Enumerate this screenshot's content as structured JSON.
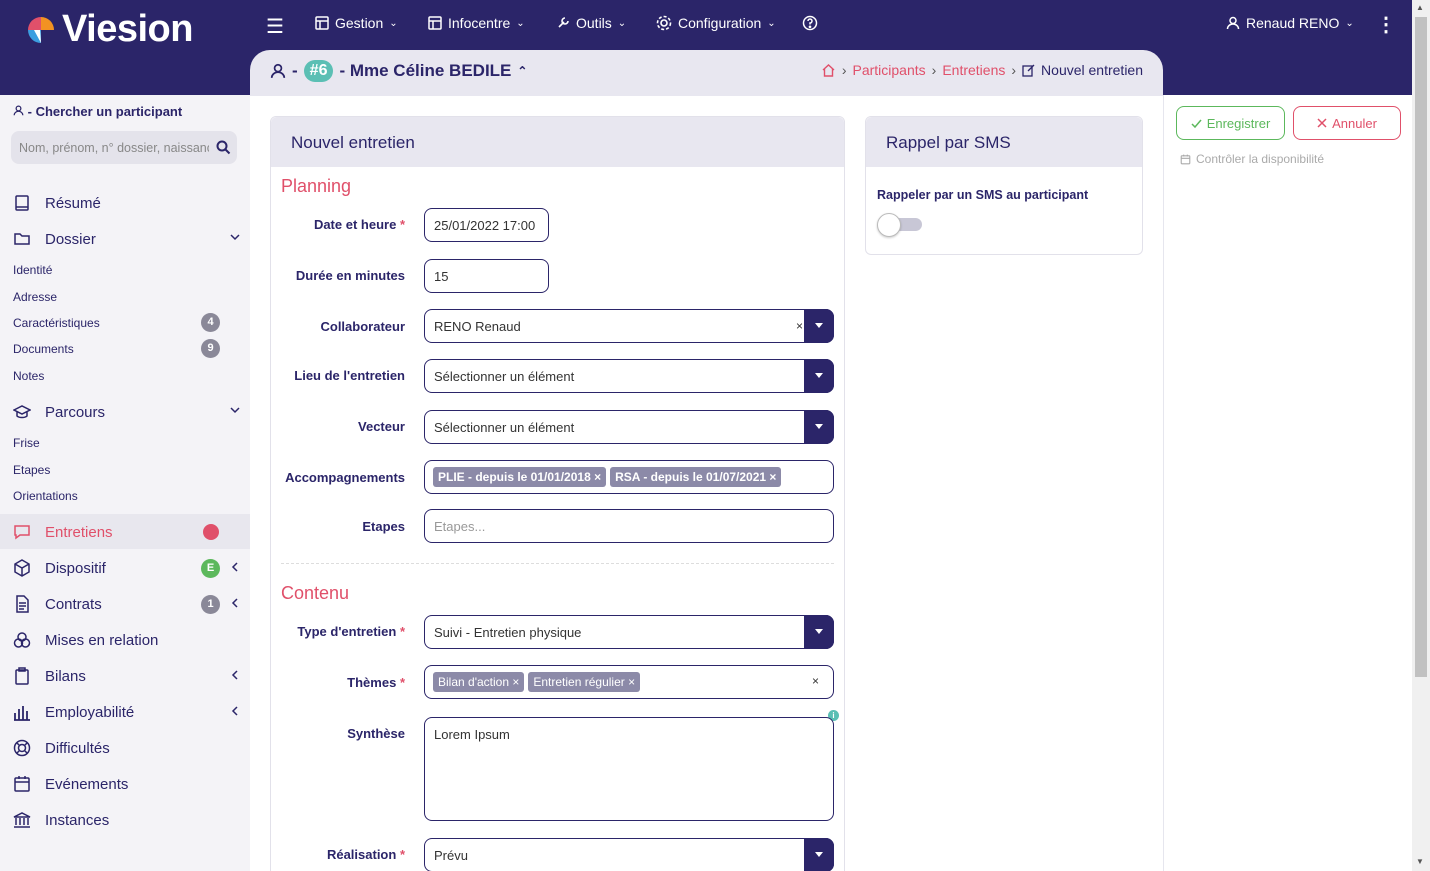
{
  "app": {
    "logo": "Viesion"
  },
  "nav": {
    "gestion": "Gestion",
    "infocentre": "Infocentre",
    "outils": "Outils",
    "configuration": "Configuration",
    "user": "Renaud RENO"
  },
  "participant": {
    "prefix": "-",
    "badge": "#6",
    "name": "- Mme Céline BEDILE"
  },
  "breadcrumb": {
    "participants": "Participants",
    "entretiens": "Entretiens",
    "current": "Nouvel entretien",
    "sep": "›"
  },
  "sidebar": {
    "search_label": "- Chercher un participant",
    "search_placeholder": "Nom, prénom, n° dossier, naissance",
    "resume": "Résumé",
    "dossier": "Dossier",
    "dossier_sub": [
      "Identité",
      "Adresse",
      "Caractéristiques",
      "Documents",
      "Notes"
    ],
    "count_caract": "4",
    "count_docs": "9",
    "parcours": "Parcours",
    "parcours_sub": [
      "Frise",
      "Etapes",
      "Orientations"
    ],
    "entretiens": "Entretiens",
    "dispositif": "Dispositif",
    "dispositif_badge": "E",
    "contrats": "Contrats",
    "contrats_count": "1",
    "mises": "Mises en relation",
    "bilans": "Bilans",
    "employabilite": "Employabilité",
    "difficultes": "Difficultés",
    "evenements": "Evénements",
    "instances": "Instances"
  },
  "form": {
    "title": "Nouvel entretien",
    "planning": "Planning",
    "date_label": "Date et heure",
    "date_value": "25/01/2022 17:00",
    "duree_label": "Durée en minutes",
    "duree_value": "15",
    "collab_label": "Collaborateur",
    "collab_value": "RENO Renaud",
    "lieu_label": "Lieu de l'entretien",
    "lieu_value": "Sélectionner un élément",
    "vecteur_label": "Vecteur",
    "vecteur_value": "Sélectionner un élément",
    "accomp_label": "Accompagnements",
    "accomp_tags": [
      "PLIE - depuis le 01/01/2018",
      "RSA - depuis le 01/07/2021"
    ],
    "etapes_label": "Etapes",
    "etapes_placeholder": "Etapes...",
    "contenu": "Contenu",
    "type_label": "Type d'entretien",
    "type_value": "Suivi - Entretien physique",
    "themes_label": "Thèmes",
    "themes_tags": [
      "Bilan d'action",
      "Entretien régulier"
    ],
    "synthese_label": "Synthèse",
    "synthese_value": "Lorem Ipsum",
    "realisation_label": "Réalisation",
    "realisation_value": "Prévu",
    "star": "*",
    "x": "×"
  },
  "sms": {
    "title": "Rappel par SMS",
    "label": "Rappeler par un SMS au participant",
    "enabled": false
  },
  "actions": {
    "save": "Enregistrer",
    "cancel": "Annuler",
    "check": "Contrôler la disponibilité"
  },
  "colors": {
    "primary": "#2b2569",
    "accent": "#e0506a",
    "teal": "#5bbfb4",
    "green": "#5cb85c"
  }
}
